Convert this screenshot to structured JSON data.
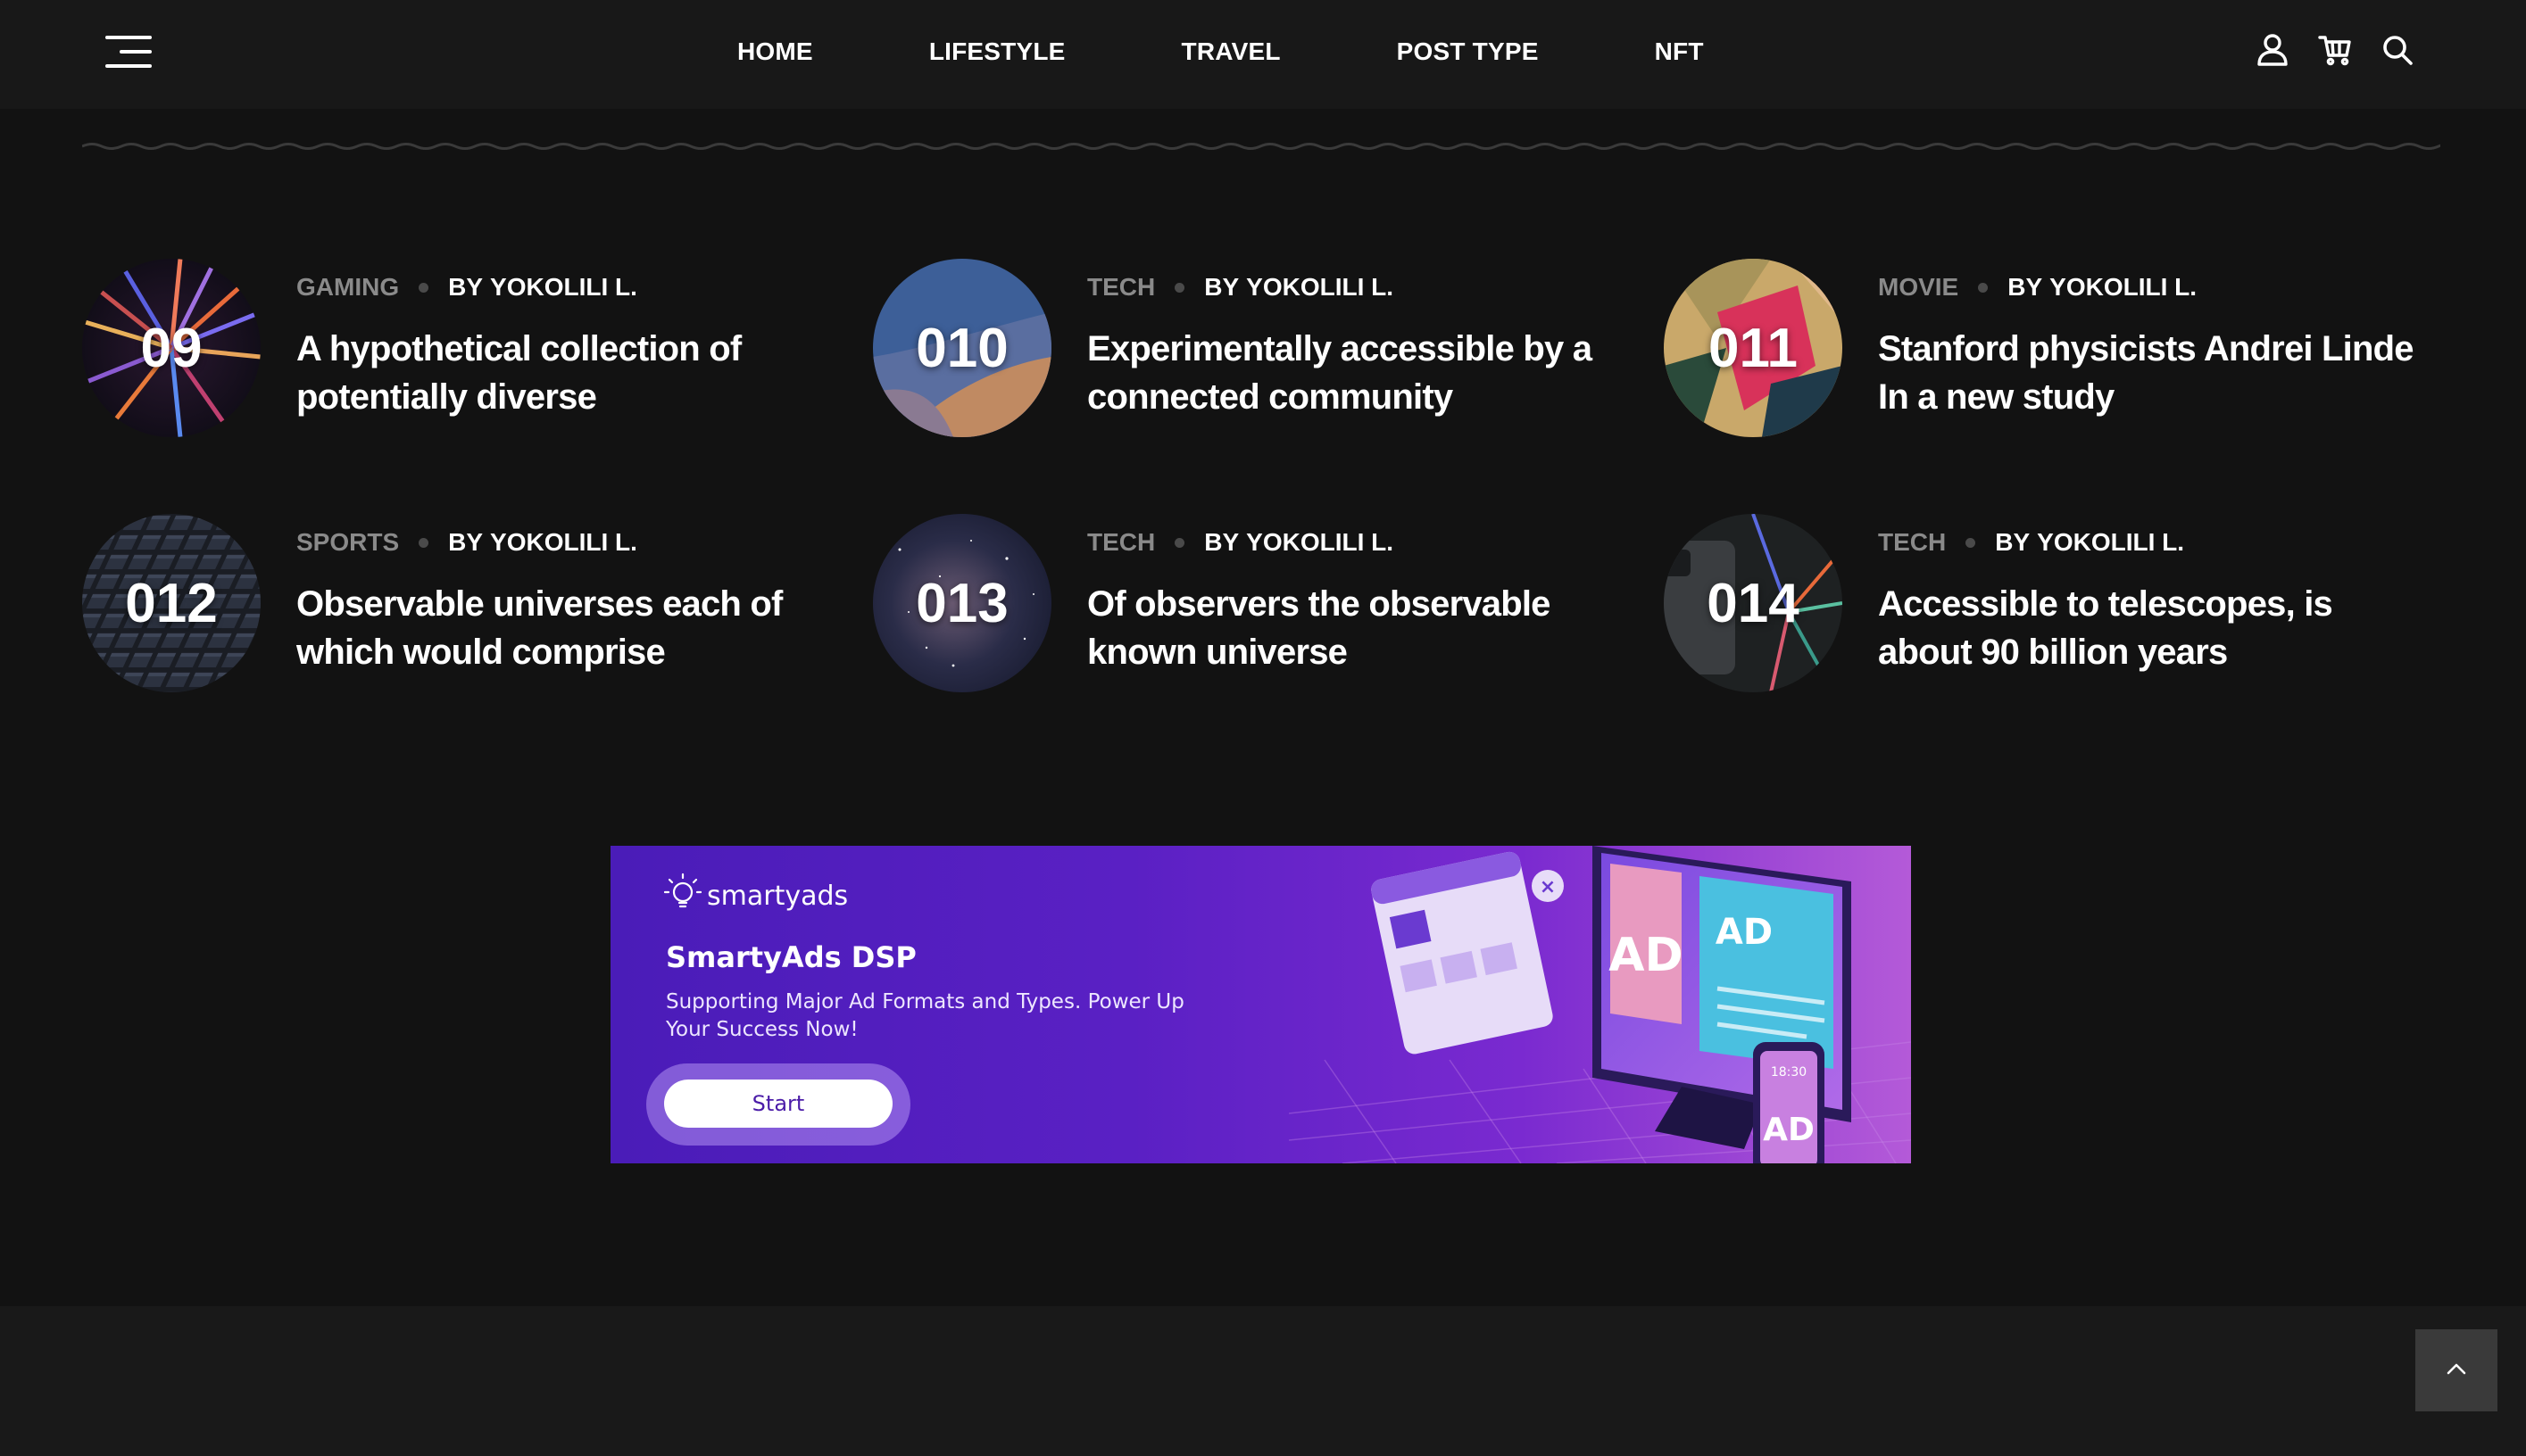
{
  "header": {
    "nav": [
      {
        "label": "HOME"
      },
      {
        "label": "LIFESTYLE"
      },
      {
        "label": "TRAVEL"
      },
      {
        "label": "POST TYPE"
      },
      {
        "label": "NFT"
      }
    ],
    "icons": [
      "hamburger-menu-icon",
      "user-icon",
      "cart-icon",
      "search-icon"
    ]
  },
  "posts": [
    {
      "number": "09",
      "category": "GAMING",
      "by": "BY",
      "author": "YOKOLILI L.",
      "title": "A hypothetical collection of potentially diverse"
    },
    {
      "number": "010",
      "category": "TECH",
      "by": "BY",
      "author": "YOKOLILI L.",
      "title": "Experimentally accessible by a connected community"
    },
    {
      "number": "011",
      "category": "MOVIE",
      "by": "BY",
      "author": "YOKOLILI L.",
      "title": "Stanford physicists Andrei Linde In a new study"
    },
    {
      "number": "012",
      "category": "SPORTS",
      "by": "BY",
      "author": "YOKOLILI L.",
      "title": "Observable universes each of which would comprise"
    },
    {
      "number": "013",
      "category": "TECH",
      "by": "BY",
      "author": "YOKOLILI L.",
      "title": "Of observers the observable known universe"
    },
    {
      "number": "014",
      "category": "TECH",
      "by": "BY",
      "author": "YOKOLILI L.",
      "title": "Accessible to telescopes, is about 90 billion years"
    }
  ],
  "ad": {
    "logo": "smartyads",
    "title": "SmartyAds DSP",
    "description": "Supporting Major Ad Formats and Types. Power Up Your Success Now!",
    "button": "Start",
    "illustration_labels": [
      "AD",
      "AD",
      "AD",
      "18:30"
    ]
  },
  "colors": {
    "background": "#121212",
    "header": "#181818",
    "category": "#8a8a8a",
    "ad_purple": "#5a20c4"
  },
  "footer": {
    "icons": [
      "chevron-up-icon"
    ]
  }
}
